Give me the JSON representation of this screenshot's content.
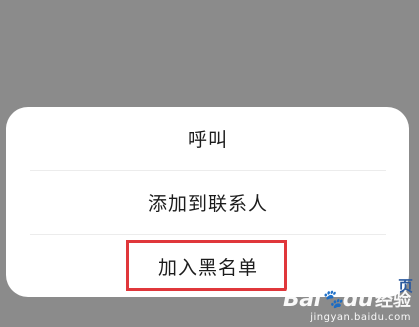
{
  "action_sheet": {
    "options": [
      {
        "label": "呼叫"
      },
      {
        "label": "添加到联系人"
      },
      {
        "label": "加入黑名单"
      }
    ],
    "highlighted_option_index": 2,
    "highlight_color": "#e0373b"
  },
  "watermark": {
    "brand_text": "Bai",
    "brand_suffix": "du",
    "secondary_text": "经验",
    "url": "jingyan.baidu.com"
  },
  "edge_glyph": "页",
  "colors": {
    "overlay": "#8b8b8b",
    "sheet_background": "#ffffff",
    "text": "#1c1c1c"
  }
}
